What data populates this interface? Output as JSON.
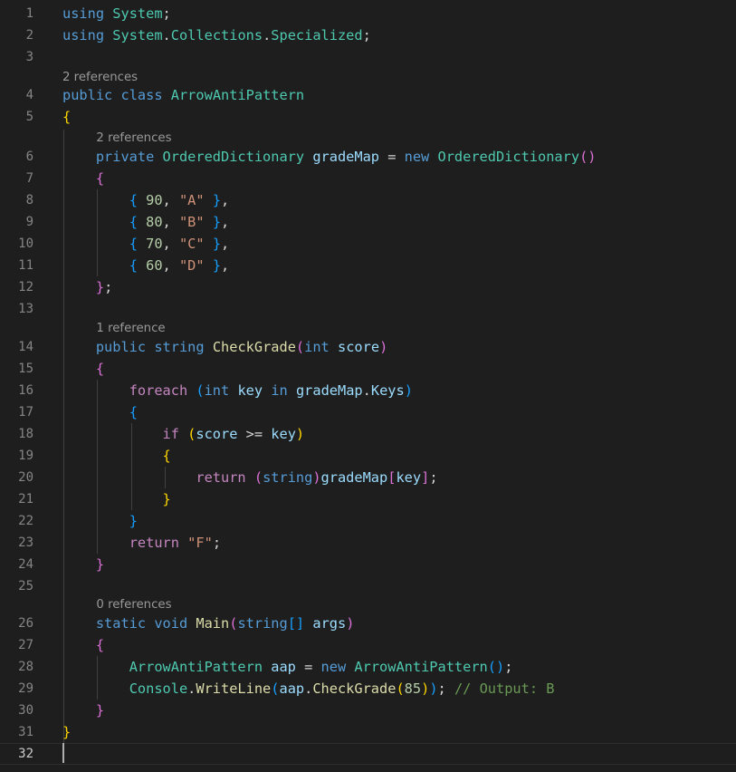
{
  "editor": {
    "language": "csharp",
    "current_line": "32",
    "code_lenses": [
      {
        "text": "2 references",
        "indent": 0
      },
      {
        "text": "2 references",
        "indent": 1
      },
      {
        "text": "1 reference",
        "indent": 1
      },
      {
        "text": "0 references",
        "indent": 1
      }
    ],
    "lines": [
      {
        "n": "1",
        "tokens": [
          [
            "using",
            "k"
          ],
          [
            " ",
            "p"
          ],
          [
            "System",
            "t"
          ],
          [
            ";",
            "p"
          ]
        ]
      },
      {
        "n": "2",
        "tokens": [
          [
            "using",
            "k"
          ],
          [
            " ",
            "p"
          ],
          [
            "System",
            "t"
          ],
          [
            ".",
            "p"
          ],
          [
            "Collections",
            "t"
          ],
          [
            ".",
            "p"
          ],
          [
            "Specialized",
            "t"
          ],
          [
            ";",
            "p"
          ]
        ]
      },
      {
        "n": "3",
        "tokens": []
      },
      {
        "n": "4",
        "tokens": [
          [
            "public",
            "k"
          ],
          [
            " ",
            "p"
          ],
          [
            "class",
            "k"
          ],
          [
            " ",
            "p"
          ],
          [
            "ArrowAntiPattern",
            "t"
          ]
        ]
      },
      {
        "n": "5",
        "tokens": [
          [
            "{",
            "b1"
          ]
        ]
      },
      {
        "n": "6",
        "tokens": [
          [
            "    ",
            "p"
          ],
          [
            "private",
            "k"
          ],
          [
            " ",
            "p"
          ],
          [
            "OrderedDictionary",
            "t"
          ],
          [
            " ",
            "p"
          ],
          [
            "gradeMap",
            "v"
          ],
          [
            " = ",
            "p"
          ],
          [
            "new",
            "k"
          ],
          [
            " ",
            "p"
          ],
          [
            "OrderedDictionary",
            "t"
          ],
          [
            "()",
            "b2"
          ]
        ]
      },
      {
        "n": "7",
        "tokens": [
          [
            "    ",
            "p"
          ],
          [
            "{",
            "b2"
          ]
        ]
      },
      {
        "n": "8",
        "tokens": [
          [
            "        ",
            "p"
          ],
          [
            "{",
            "b3"
          ],
          [
            " ",
            "p"
          ],
          [
            "90",
            "n"
          ],
          [
            ", ",
            "p"
          ],
          [
            "\"A\"",
            "s"
          ],
          [
            " ",
            "p"
          ],
          [
            "}",
            "b3"
          ],
          [
            ",",
            "p"
          ]
        ]
      },
      {
        "n": "9",
        "tokens": [
          [
            "        ",
            "p"
          ],
          [
            "{",
            "b3"
          ],
          [
            " ",
            "p"
          ],
          [
            "80",
            "n"
          ],
          [
            ", ",
            "p"
          ],
          [
            "\"B\"",
            "s"
          ],
          [
            " ",
            "p"
          ],
          [
            "}",
            "b3"
          ],
          [
            ",",
            "p"
          ]
        ]
      },
      {
        "n": "10",
        "tokens": [
          [
            "        ",
            "p"
          ],
          [
            "{",
            "b3"
          ],
          [
            " ",
            "p"
          ],
          [
            "70",
            "n"
          ],
          [
            ", ",
            "p"
          ],
          [
            "\"C\"",
            "s"
          ],
          [
            " ",
            "p"
          ],
          [
            "}",
            "b3"
          ],
          [
            ",",
            "p"
          ]
        ]
      },
      {
        "n": "11",
        "tokens": [
          [
            "        ",
            "p"
          ],
          [
            "{",
            "b3"
          ],
          [
            " ",
            "p"
          ],
          [
            "60",
            "n"
          ],
          [
            ", ",
            "p"
          ],
          [
            "\"D\"",
            "s"
          ],
          [
            " ",
            "p"
          ],
          [
            "}",
            "b3"
          ],
          [
            ",",
            "p"
          ]
        ]
      },
      {
        "n": "12",
        "tokens": [
          [
            "    ",
            "p"
          ],
          [
            "}",
            "b2"
          ],
          [
            ";",
            "p"
          ]
        ]
      },
      {
        "n": "13",
        "tokens": []
      },
      {
        "n": "14",
        "tokens": [
          [
            "    ",
            "p"
          ],
          [
            "public",
            "k"
          ],
          [
            " ",
            "p"
          ],
          [
            "string",
            "k"
          ],
          [
            " ",
            "p"
          ],
          [
            "CheckGrade",
            "f"
          ],
          [
            "(",
            "b2"
          ],
          [
            "int",
            "k"
          ],
          [
            " ",
            "p"
          ],
          [
            "score",
            "v"
          ],
          [
            ")",
            "b2"
          ]
        ]
      },
      {
        "n": "15",
        "tokens": [
          [
            "    ",
            "p"
          ],
          [
            "{",
            "b2"
          ]
        ]
      },
      {
        "n": "16",
        "tokens": [
          [
            "        ",
            "p"
          ],
          [
            "foreach",
            "kc"
          ],
          [
            " ",
            "p"
          ],
          [
            "(",
            "b3"
          ],
          [
            "int",
            "k"
          ],
          [
            " ",
            "p"
          ],
          [
            "key",
            "v"
          ],
          [
            " ",
            "p"
          ],
          [
            "in",
            "k"
          ],
          [
            " ",
            "p"
          ],
          [
            "gradeMap",
            "v"
          ],
          [
            ".",
            "p"
          ],
          [
            "Keys",
            "v"
          ],
          [
            ")",
            "b3"
          ]
        ]
      },
      {
        "n": "17",
        "tokens": [
          [
            "        ",
            "p"
          ],
          [
            "{",
            "b3"
          ]
        ]
      },
      {
        "n": "18",
        "tokens": [
          [
            "            ",
            "p"
          ],
          [
            "if",
            "kc"
          ],
          [
            " ",
            "p"
          ],
          [
            "(",
            "b1"
          ],
          [
            "score",
            "v"
          ],
          [
            " >= ",
            "p"
          ],
          [
            "key",
            "v"
          ],
          [
            ")",
            "b1"
          ]
        ]
      },
      {
        "n": "19",
        "tokens": [
          [
            "            ",
            "p"
          ],
          [
            "{",
            "b1"
          ]
        ]
      },
      {
        "n": "20",
        "tokens": [
          [
            "                ",
            "p"
          ],
          [
            "return",
            "kc"
          ],
          [
            " ",
            "p"
          ],
          [
            "(",
            "b2"
          ],
          [
            "string",
            "k"
          ],
          [
            ")",
            "b2"
          ],
          [
            "gradeMap",
            "v"
          ],
          [
            "[",
            "b2"
          ],
          [
            "key",
            "v"
          ],
          [
            "]",
            "b2"
          ],
          [
            ";",
            "p"
          ]
        ]
      },
      {
        "n": "21",
        "tokens": [
          [
            "            ",
            "p"
          ],
          [
            "}",
            "b1"
          ]
        ]
      },
      {
        "n": "22",
        "tokens": [
          [
            "        ",
            "p"
          ],
          [
            "}",
            "b3"
          ]
        ]
      },
      {
        "n": "23",
        "tokens": [
          [
            "        ",
            "p"
          ],
          [
            "return",
            "kc"
          ],
          [
            " ",
            "p"
          ],
          [
            "\"F\"",
            "s"
          ],
          [
            ";",
            "p"
          ]
        ]
      },
      {
        "n": "24",
        "tokens": [
          [
            "    ",
            "p"
          ],
          [
            "}",
            "b2"
          ]
        ]
      },
      {
        "n": "25",
        "tokens": []
      },
      {
        "n": "26",
        "tokens": [
          [
            "    ",
            "p"
          ],
          [
            "static",
            "k"
          ],
          [
            " ",
            "p"
          ],
          [
            "void",
            "k"
          ],
          [
            " ",
            "p"
          ],
          [
            "Main",
            "f"
          ],
          [
            "(",
            "b2"
          ],
          [
            "string",
            "k"
          ],
          [
            "[]",
            "b3"
          ],
          [
            " ",
            "p"
          ],
          [
            "args",
            "v"
          ],
          [
            ")",
            "b2"
          ]
        ]
      },
      {
        "n": "27",
        "tokens": [
          [
            "    ",
            "p"
          ],
          [
            "{",
            "b2"
          ]
        ]
      },
      {
        "n": "28",
        "tokens": [
          [
            "        ",
            "p"
          ],
          [
            "ArrowAntiPattern",
            "t"
          ],
          [
            " ",
            "p"
          ],
          [
            "aap",
            "v"
          ],
          [
            " = ",
            "p"
          ],
          [
            "new",
            "k"
          ],
          [
            " ",
            "p"
          ],
          [
            "ArrowAntiPattern",
            "t"
          ],
          [
            "()",
            "b3"
          ],
          [
            ";",
            "p"
          ]
        ]
      },
      {
        "n": "29",
        "tokens": [
          [
            "        ",
            "p"
          ],
          [
            "Console",
            "t"
          ],
          [
            ".",
            "p"
          ],
          [
            "WriteLine",
            "f"
          ],
          [
            "(",
            "b3"
          ],
          [
            "aap",
            "v"
          ],
          [
            ".",
            "p"
          ],
          [
            "CheckGrade",
            "f"
          ],
          [
            "(",
            "b1"
          ],
          [
            "85",
            "n"
          ],
          [
            ")",
            "b1"
          ],
          [
            ")",
            "b3"
          ],
          [
            ";",
            "p"
          ],
          [
            " ",
            "p"
          ],
          [
            "// Output: B",
            "c"
          ]
        ]
      },
      {
        "n": "30",
        "tokens": [
          [
            "    ",
            "p"
          ],
          [
            "}",
            "b2"
          ]
        ]
      },
      {
        "n": "31",
        "tokens": [
          [
            "}",
            "b1"
          ]
        ]
      },
      {
        "n": "32",
        "tokens": []
      }
    ]
  }
}
